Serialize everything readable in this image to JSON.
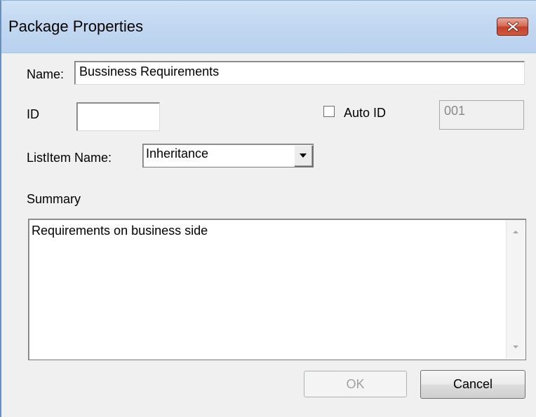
{
  "window": {
    "title": "Package Properties",
    "close_icon": "close-icon"
  },
  "form": {
    "name_label": "Name:",
    "name_value": "Bussiness Requirements",
    "id_label": "ID",
    "id_value": "",
    "auto_id_label": "Auto ID",
    "auto_id_checked": false,
    "auto_id_value": "001",
    "listitem_label": "ListItem Name:",
    "listitem_value": "Inheritance",
    "summary_label": "Summary",
    "summary_value": "Requirements on business side"
  },
  "buttons": {
    "ok_label": "OK",
    "ok_enabled": false,
    "cancel_label": "Cancel"
  },
  "colors": {
    "titlebar": "#c2d8f1",
    "close_button": "#c94a33",
    "dialog_background": "#f0f0f0"
  }
}
